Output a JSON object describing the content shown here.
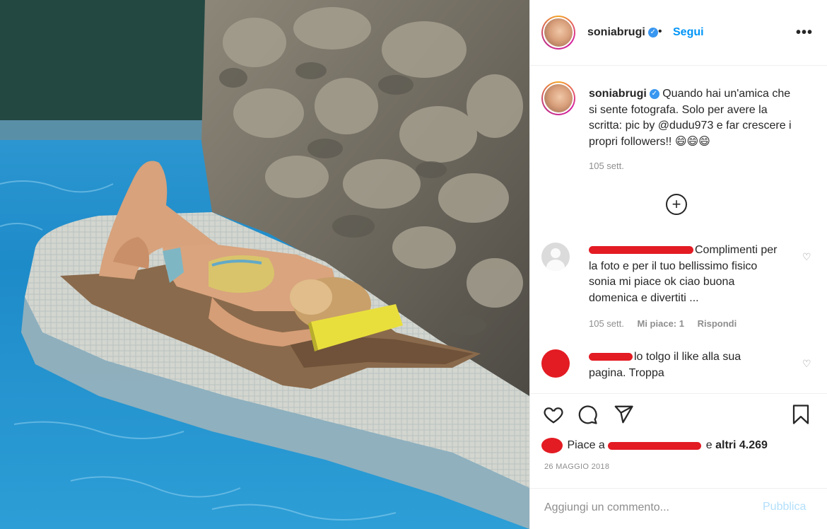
{
  "post": {
    "username": "soniabrugi",
    "follow_label": "Segui",
    "more_label": "•••",
    "dot": "•"
  },
  "caption": {
    "username": "soniabrugi",
    "text": "Quando hai un'amica che si sente fotografa. Solo per avere la scritta: pic by @dudu973 e far crescere i propri followers!! 😄😄😄",
    "time": "105 sett."
  },
  "load_more_label": "+",
  "comments": [
    {
      "text": "Complimenti per la foto e per il tuo bellissimo fisico sonia mi piace ok ciao buona domenica e divertiti ...",
      "time": "105 sett.",
      "likes": "Mi piace: 1",
      "reply": "Rispondi"
    },
    {
      "text": "lo tolgo il like alla sua pagina. Troppa"
    }
  ],
  "likes": {
    "prefix": "Piace a",
    "middle": "e",
    "others": "altri 4.269"
  },
  "date": "26 MAGGIO 2018",
  "add_comment": {
    "placeholder": "Aggiungi un commento...",
    "post_label": "Pubblica"
  },
  "icons": {
    "heart": "heart-icon",
    "comment": "comment-icon",
    "share": "paper-plane-icon",
    "save": "bookmark-icon",
    "verified": "verified-badge-icon"
  },
  "colors": {
    "link_blue": "#0095f6",
    "verified_blue": "#3897f0",
    "redact_red": "#e31b23",
    "muted": "#8e8e8e"
  }
}
